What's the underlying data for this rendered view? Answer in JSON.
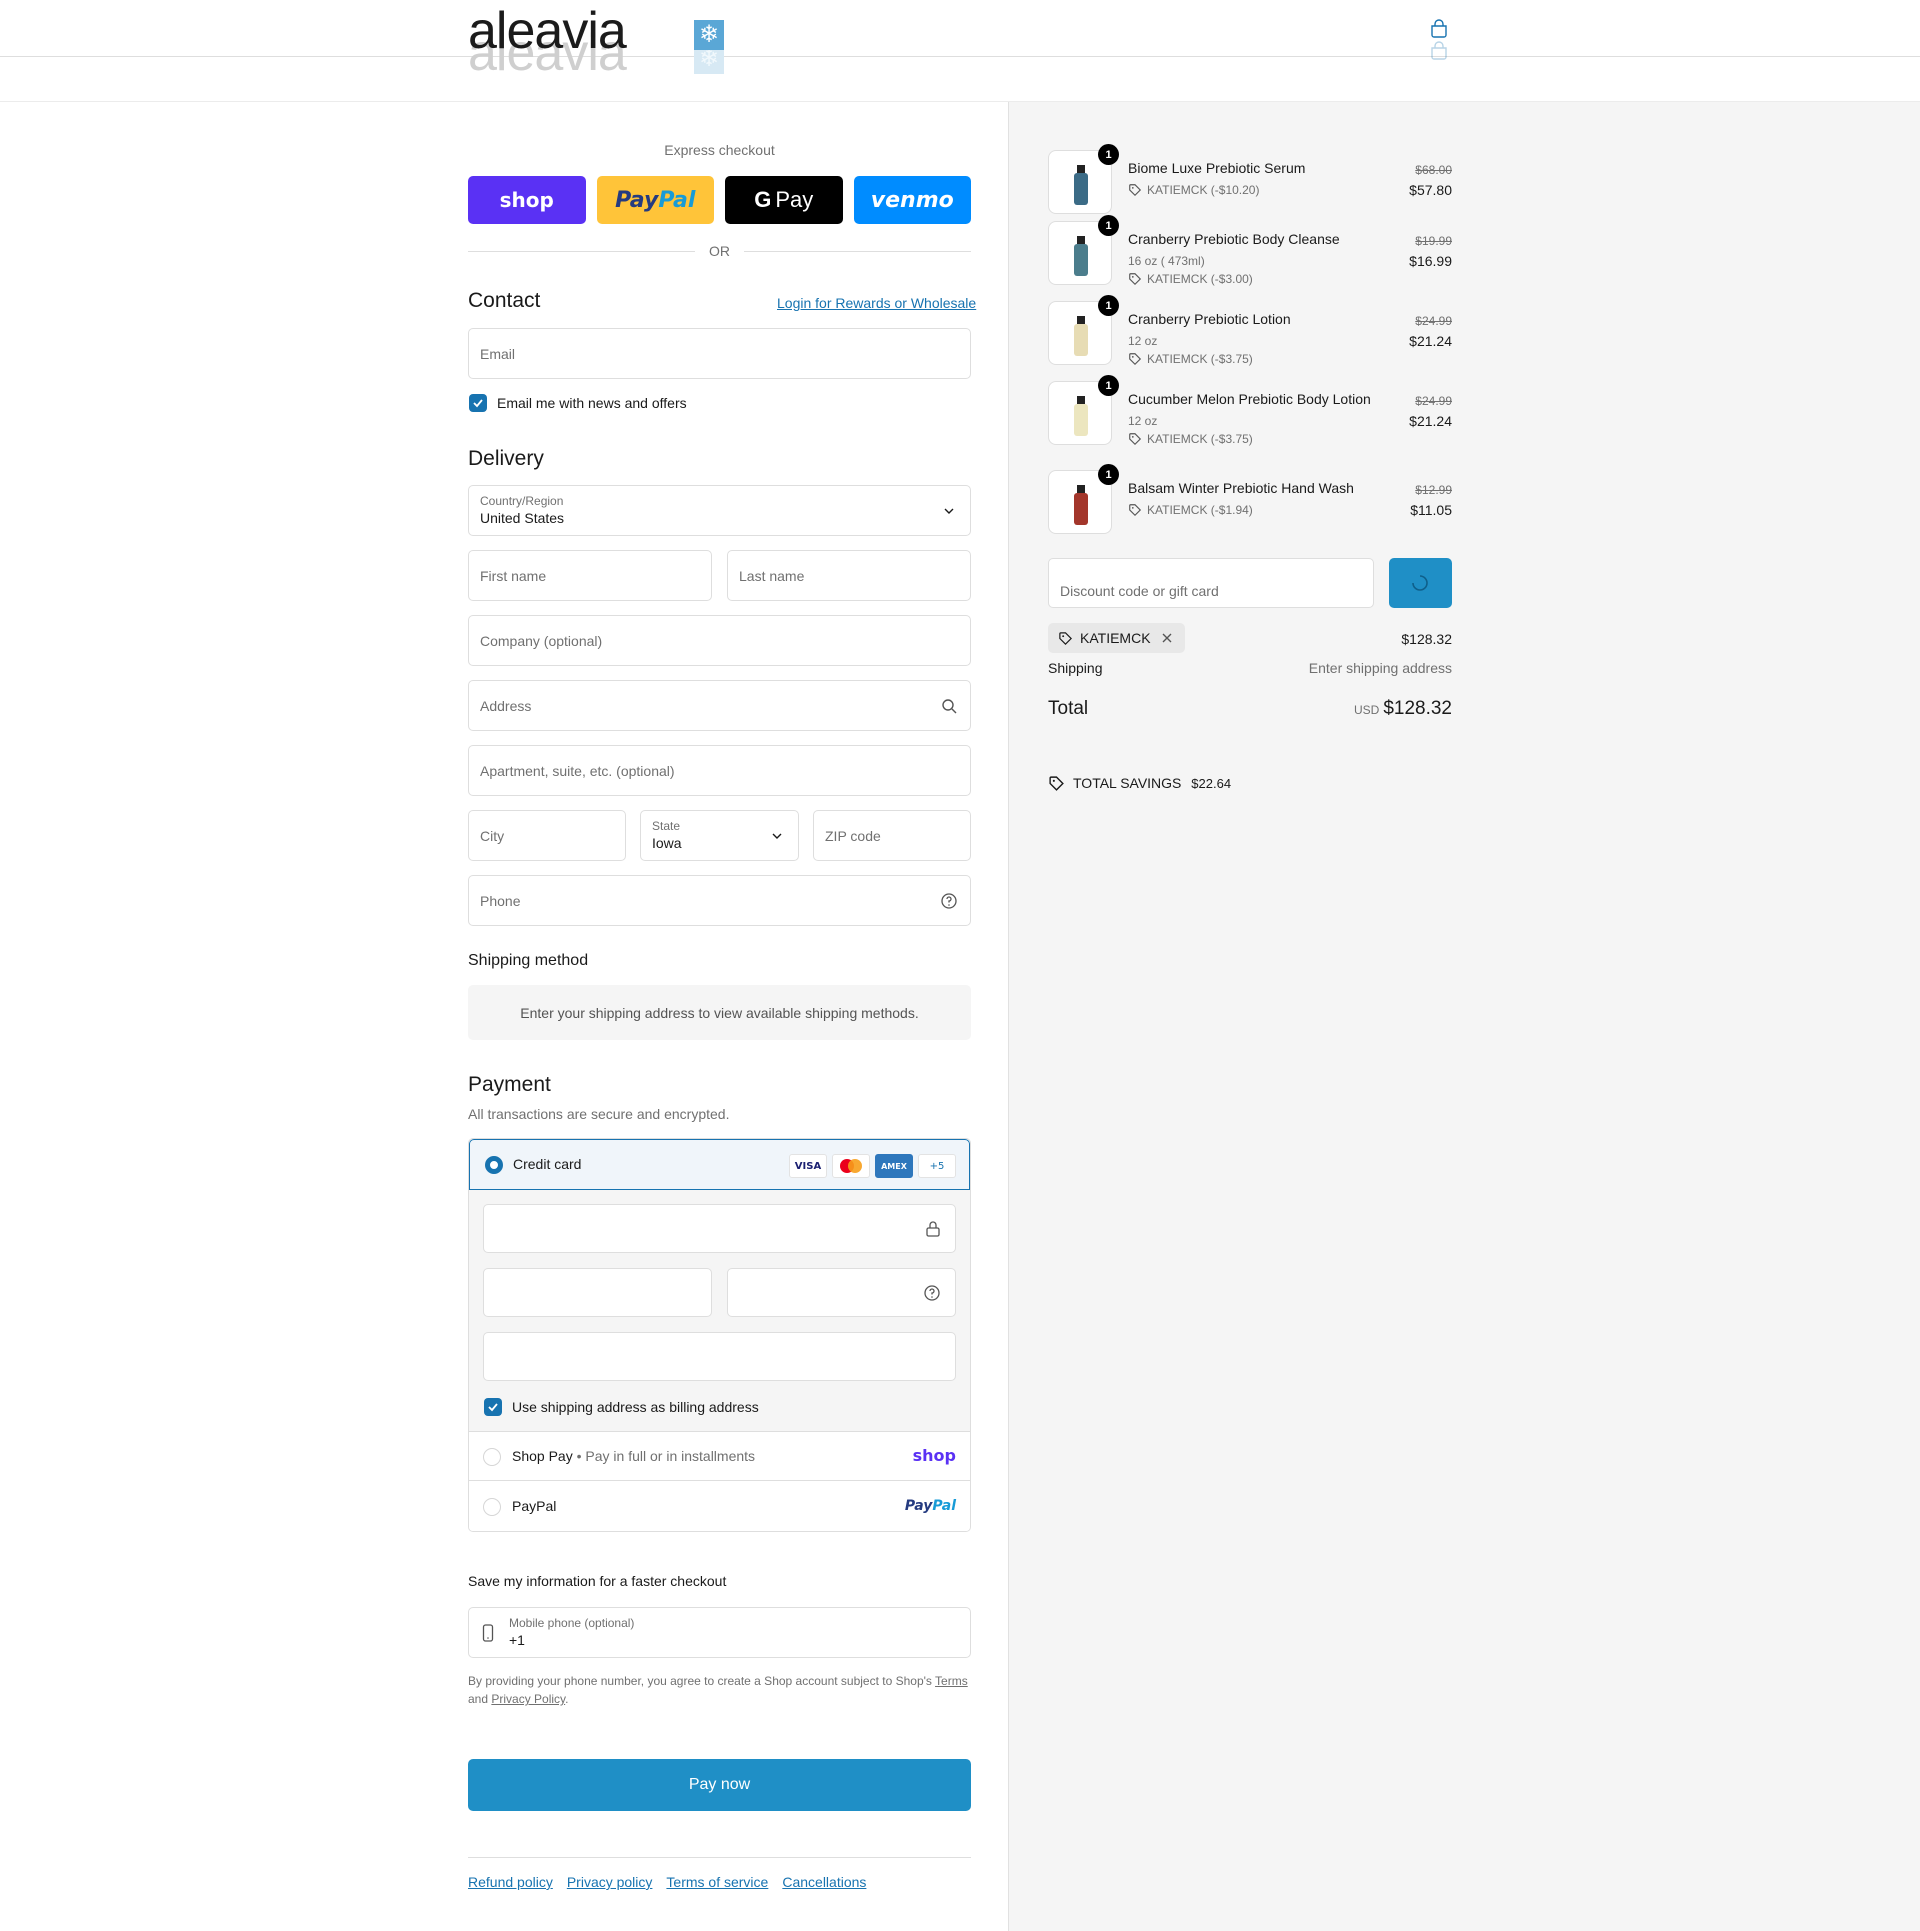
{
  "brand": {
    "name": "aleavia",
    "snowflake": "❄"
  },
  "express": {
    "title": "Express checkout",
    "buttons": {
      "shop": "shop",
      "paypal_a": "Pay",
      "paypal_b": "Pal",
      "gpay_g": "G",
      "gpay": "Pay",
      "venmo": "venmo"
    },
    "or": "OR"
  },
  "contact": {
    "title": "Contact",
    "login_link": "Login for Rewards or Wholesale",
    "email_placeholder": "Email",
    "newsletter_label": "Email me with news and offers"
  },
  "delivery": {
    "title": "Delivery",
    "country_label": "Country/Region",
    "country_value": "United States",
    "first_name": "First name",
    "last_name": "Last name",
    "company": "Company (optional)",
    "address": "Address",
    "apartment": "Apartment, suite, etc. (optional)",
    "city": "City",
    "state_label": "State",
    "state_value": "Iowa",
    "zip": "ZIP code",
    "phone": "Phone"
  },
  "shipping_method": {
    "title": "Shipping method",
    "note": "Enter your shipping address to view available shipping methods."
  },
  "payment": {
    "title": "Payment",
    "subtitle": "All transactions are secure and encrypted.",
    "credit_card": "Credit card",
    "card_logos": {
      "visa": "VISA",
      "amex": "AMEX",
      "more": "+5"
    },
    "billing_same": "Use shipping address as billing address",
    "shop_pay": "Shop Pay",
    "shop_pay_sep": "•",
    "shop_pay_sub": "Pay in full or in installments",
    "shop_pay_logo": "shop",
    "paypal": "PayPal",
    "paypal_logo_a": "Pay",
    "paypal_logo_b": "Pal"
  },
  "save_info": {
    "title": "Save my information for a faster checkout",
    "mobile_label": "Mobile phone (optional)",
    "mobile_value": "+1",
    "legal_a": "By providing your phone number, you agree to create a Shop account subject to Shop's ",
    "legal_terms": "Terms",
    "legal_b": "and ",
    "legal_privacy": "Privacy Policy",
    "legal_c": "."
  },
  "pay_now": "Pay now",
  "footer_links": [
    "Refund policy",
    "Privacy policy",
    "Terms of service",
    "Cancellations"
  ],
  "summary": {
    "items": [
      {
        "name": "Biome Luxe Prebiotic Serum",
        "variant": "",
        "discount": "KATIEMCK (-$10.20)",
        "original": "$68.00",
        "price": "$57.80",
        "qty": "1",
        "color": "#3b6b86"
      },
      {
        "name": "Cranberry Prebiotic Body Cleanse",
        "variant": "16 oz ( 473ml)",
        "discount": "KATIEMCK (-$3.00)",
        "original": "$19.99",
        "price": "$16.99",
        "qty": "1",
        "color": "#4b7d8c"
      },
      {
        "name": "Cranberry Prebiotic Lotion",
        "variant": "12 oz",
        "discount": "KATIEMCK (-$3.75)",
        "original": "$24.99",
        "price": "$21.24",
        "qty": "1",
        "color": "#e7dcb4"
      },
      {
        "name": "Cucumber Melon Prebiotic Body Lotion",
        "variant": "12 oz",
        "discount": "KATIEMCK (-$3.75)",
        "original": "$24.99",
        "price": "$21.24",
        "qty": "1",
        "color": "#ece6bf"
      },
      {
        "name": "Balsam Winter Prebiotic Hand Wash",
        "variant": "",
        "discount": "KATIEMCK (-$1.94)",
        "original": "$12.99",
        "price": "$11.05",
        "qty": "1",
        "color": "#a3362b"
      }
    ],
    "discount_placeholder": "Discount code or gift card",
    "applied_code": "KATIEMCK",
    "subtotal": "$128.32",
    "shipping_label": "Shipping",
    "shipping_value": "Enter shipping address",
    "total_label": "Total",
    "currency": "USD",
    "total": "$128.32",
    "savings_label": "TOTAL SAVINGS",
    "savings_value": "$22.64"
  },
  "colors": {
    "accent": "#1773b0",
    "button": "#1f8fc6",
    "shop": "#5a31f4",
    "paypal": "#ffc439",
    "venmo": "#008cff"
  }
}
